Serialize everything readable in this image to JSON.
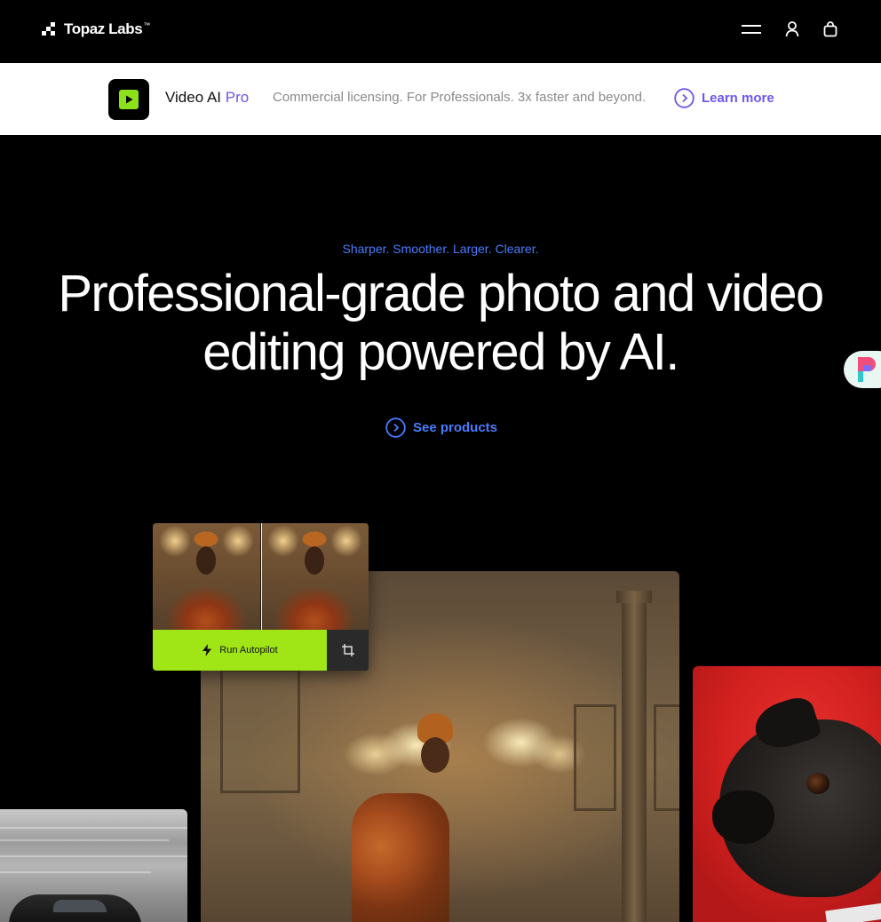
{
  "nav": {
    "brand": "Topaz Labs",
    "brand_tm": "™",
    "icons": [
      "menu-icon",
      "account-icon",
      "cart-icon"
    ]
  },
  "promo": {
    "product_name": "Video AI",
    "product_tier": "Pro",
    "tagline": "Commercial licensing. For Professionals. 3x faster and beyond.",
    "cta": "Learn more",
    "accent_color": "#6d55f0",
    "app_icon_color": "#8be21b"
  },
  "hero": {
    "eyebrow": "Sharper. Smoother. Larger. Clearer.",
    "headline": "Professional-grade photo and video editing powered by AI.",
    "cta": "See products",
    "link_color": "#4a7cff"
  },
  "showcase": {
    "autopilot_button": "Run Autopilot",
    "autopilot_color": "#a0e515"
  }
}
